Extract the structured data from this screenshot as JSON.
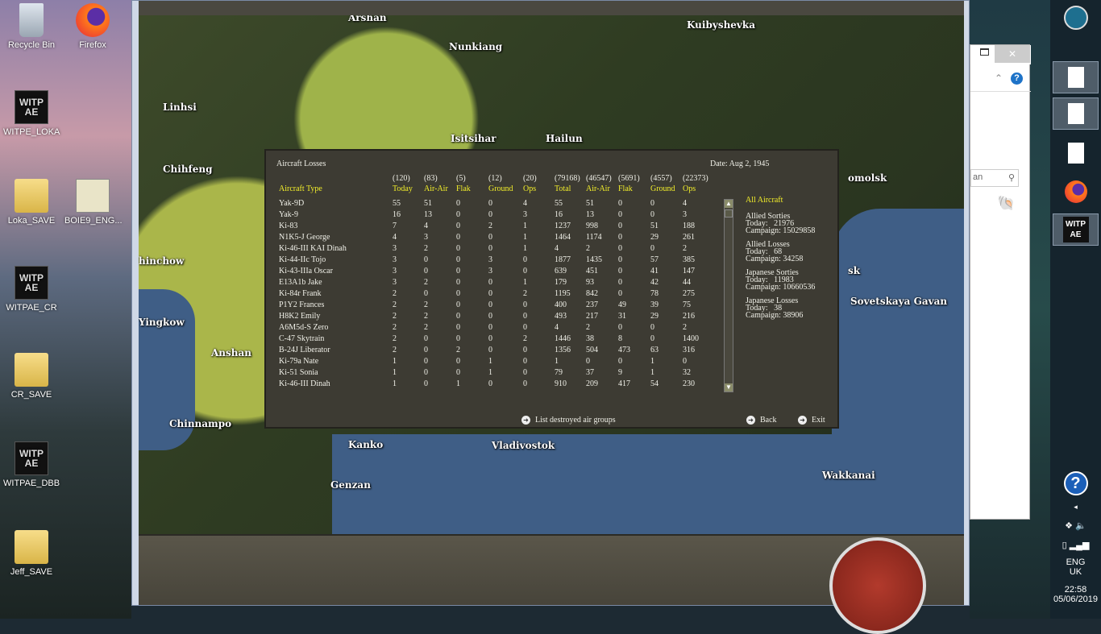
{
  "desktop": {
    "icons": [
      {
        "label": "Recycle Bin",
        "icon": "recycle-bin-icon"
      },
      {
        "label": "Firefox",
        "icon": "firefox-icon"
      },
      {
        "label": "WITPE_LOKA",
        "icon": "witp-ae-icon"
      },
      {
        "label": "Loka_SAVE",
        "icon": "folder-icon"
      },
      {
        "label": "BOIE9_ENG...",
        "icon": "installer-icon"
      },
      {
        "label": "WITPAE_CR",
        "icon": "witp-ae-icon"
      },
      {
        "label": "CR_SAVE",
        "icon": "folder-icon"
      },
      {
        "label": "WITPAE_DBB",
        "icon": "witp-ae-icon"
      },
      {
        "label": "Jeff_SAVE",
        "icon": "folder-icon"
      }
    ],
    "witp_logo": "WITP AE"
  },
  "map": {
    "cities": [
      "Arshan",
      "Kuibyshevka",
      "Nunkiang",
      "Linhsi",
      "Isitsihar",
      "Hailun",
      "Chihfeng",
      "hinchow",
      "Yingkow",
      "Anshan",
      "Chinnampo",
      "Kanko",
      "Vladivostok",
      "Genzan",
      "Wakkanai",
      "Sovetskaya Gavan",
      "omolsk",
      "sk"
    ]
  },
  "dialog": {
    "title": "Aircraft Losses",
    "date": "Date: Aug 2, 1945",
    "totals": [
      "(120)",
      "(83)",
      "(5)",
      "(12)",
      "(20)",
      "(79168)",
      "(46547)",
      "(5691)",
      "(4557)",
      "(22373)"
    ],
    "headers": [
      "Aircraft Type",
      "Today",
      "Air-Air",
      "Flak",
      "Ground",
      "Ops",
      "Total",
      "Air-Air",
      "Flak",
      "Ground",
      "Ops"
    ],
    "rows": [
      [
        "Yak-9D",
        "55",
        "51",
        "0",
        "0",
        "4",
        "55",
        "51",
        "0",
        "0",
        "4"
      ],
      [
        "Yak-9",
        "16",
        "13",
        "0",
        "0",
        "3",
        "16",
        "13",
        "0",
        "0",
        "3"
      ],
      [
        "Ki-83",
        "7",
        "4",
        "0",
        "2",
        "1",
        "1237",
        "998",
        "0",
        "51",
        "188"
      ],
      [
        "N1K5-J George",
        "4",
        "3",
        "0",
        "0",
        "1",
        "1464",
        "1174",
        "0",
        "29",
        "261"
      ],
      [
        "Ki-46-III KAI Dinah",
        "3",
        "2",
        "0",
        "0",
        "1",
        "4",
        "2",
        "0",
        "0",
        "2"
      ],
      [
        "Ki-44-IIc Tojo",
        "3",
        "0",
        "0",
        "3",
        "0",
        "1877",
        "1435",
        "0",
        "57",
        "385"
      ],
      [
        "Ki-43-IIIa Oscar",
        "3",
        "0",
        "0",
        "3",
        "0",
        "639",
        "451",
        "0",
        "41",
        "147"
      ],
      [
        "E13A1b Jake",
        "3",
        "2",
        "0",
        "0",
        "1",
        "179",
        "93",
        "0",
        "42",
        "44"
      ],
      [
        "Ki-84r Frank",
        "2",
        "0",
        "0",
        "0",
        "2",
        "1195",
        "842",
        "0",
        "78",
        "275"
      ],
      [
        "P1Y2 Frances",
        "2",
        "2",
        "0",
        "0",
        "0",
        "400",
        "237",
        "49",
        "39",
        "75"
      ],
      [
        "H8K2 Emily",
        "2",
        "2",
        "0",
        "0",
        "0",
        "493",
        "217",
        "31",
        "29",
        "216"
      ],
      [
        "A6M5d-S Zero",
        "2",
        "2",
        "0",
        "0",
        "0",
        "4",
        "2",
        "0",
        "0",
        "2"
      ],
      [
        "C-47 Skytrain",
        "2",
        "0",
        "0",
        "0",
        "2",
        "1446",
        "38",
        "8",
        "0",
        "1400"
      ],
      [
        "B-24J Liberator",
        "2",
        "0",
        "2",
        "0",
        "0",
        "1356",
        "504",
        "473",
        "63",
        "316"
      ],
      [
        "Ki-79a Nate",
        "1",
        "0",
        "0",
        "1",
        "0",
        "1",
        "0",
        "0",
        "1",
        "0"
      ],
      [
        "Ki-51 Sonia",
        "1",
        "0",
        "0",
        "1",
        "0",
        "79",
        "37",
        "9",
        "1",
        "32"
      ],
      [
        "Ki-46-III Dinah",
        "1",
        "0",
        "1",
        "0",
        "0",
        "910",
        "209",
        "417",
        "54",
        "230"
      ]
    ],
    "summary": {
      "heading": "All Aircraft",
      "allied_sorties": {
        "label": "Allied Sorties",
        "today": "Today:   21976",
        "campaign": "Campaign: 15029858"
      },
      "allied_losses": {
        "label": "Allied Losses",
        "today": "Today:   68",
        "campaign": "Campaign: 34258"
      },
      "japanese_sorties": {
        "label": "Japanese Sorties",
        "today": "Today:   11983",
        "campaign": "Campaign: 10660536"
      },
      "japanese_losses": {
        "label": "Japanese Losses",
        "today": "Today:   38",
        "campaign": "Campaign: 38906"
      }
    },
    "buttons": {
      "list": "List destroyed air groups",
      "back": "Back",
      "exit": "Exit"
    }
  },
  "explorer": {
    "search_partial": "an",
    "help": "?",
    "close": "✕"
  },
  "taskbar": {
    "lang": "ENG",
    "region": "UK",
    "time": "22:58",
    "date": "05/06/2019",
    "help": "?",
    "witp": "WITP AE"
  }
}
